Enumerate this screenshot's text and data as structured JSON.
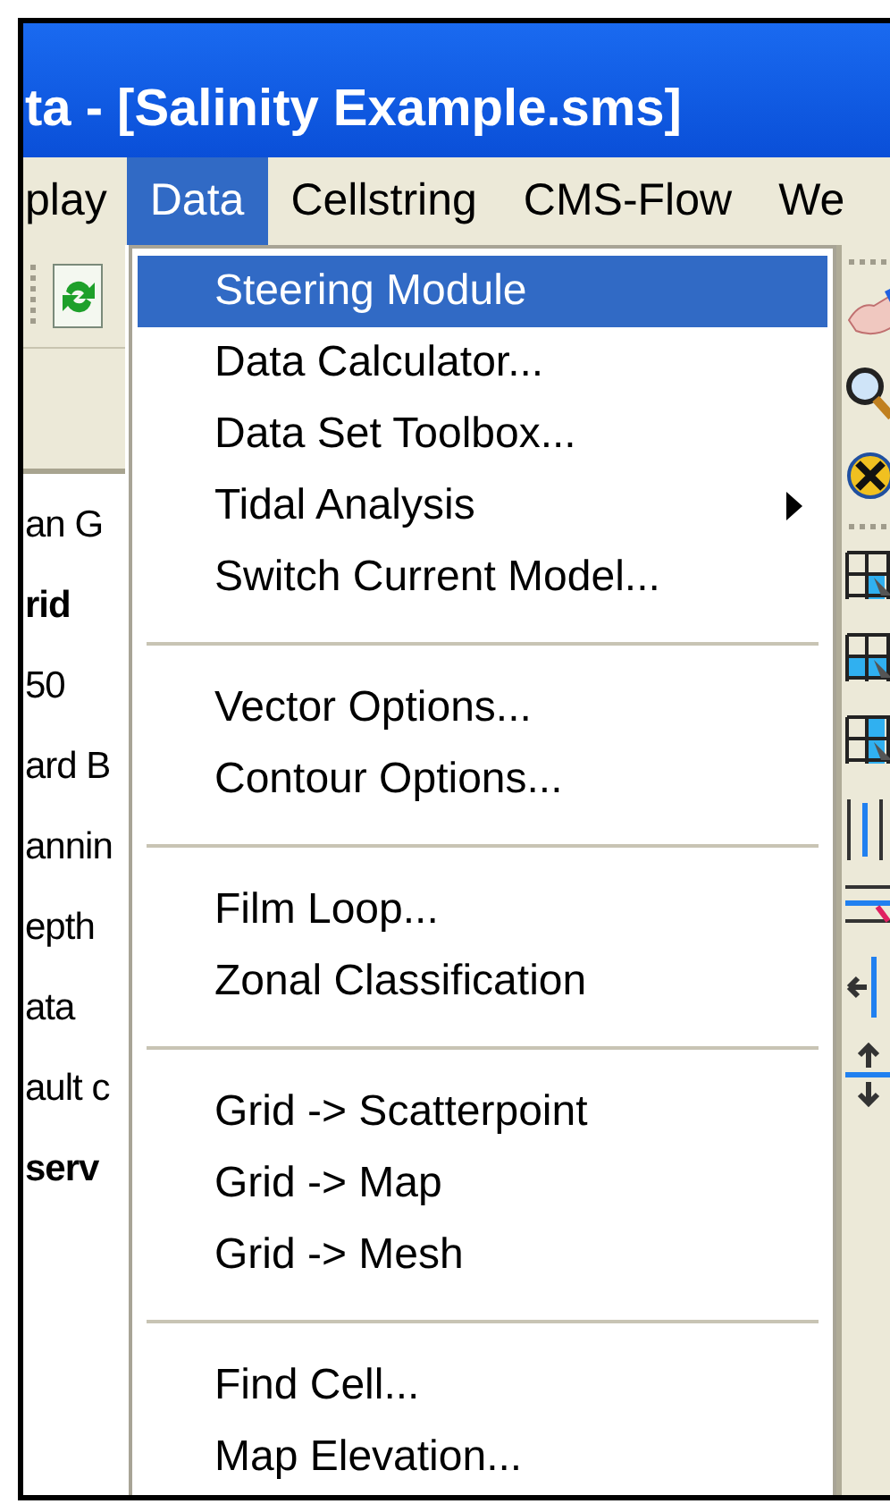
{
  "window": {
    "title": "ta - [Salinity Example.sms]"
  },
  "menu_bar": [
    {
      "label": "play",
      "selected": false
    },
    {
      "label": "Data",
      "selected": true
    },
    {
      "label": "Cellstring",
      "selected": false
    },
    {
      "label": "CMS-Flow",
      "selected": false
    },
    {
      "label": "We",
      "selected": false
    }
  ],
  "tree": {
    "items": [
      {
        "label": "an G",
        "bold": false
      },
      {
        "label": "rid",
        "bold": true
      },
      {
        "label": "50",
        "bold": false
      },
      {
        "label": "ard B",
        "bold": false
      },
      {
        "label": "annin",
        "bold": false
      },
      {
        "label": "epth",
        "bold": false
      },
      {
        "label": "ata",
        "bold": false
      },
      {
        "label": "ault c",
        "bold": false
      },
      {
        "label": "serv",
        "bold": true
      }
    ]
  },
  "data_menu": {
    "items": [
      {
        "kind": "item",
        "label": "Steering Module",
        "selected": true,
        "submenu": false
      },
      {
        "kind": "item",
        "label": "Data Calculator...",
        "selected": false,
        "submenu": false
      },
      {
        "kind": "item",
        "label": "Data Set Toolbox...",
        "selected": false,
        "submenu": false
      },
      {
        "kind": "item",
        "label": "Tidal Analysis",
        "selected": false,
        "submenu": true
      },
      {
        "kind": "item",
        "label": "Switch Current Model...",
        "selected": false,
        "submenu": false
      },
      {
        "kind": "separator"
      },
      {
        "kind": "item",
        "label": "Vector Options...",
        "selected": false,
        "submenu": false
      },
      {
        "kind": "item",
        "label": "Contour Options...",
        "selected": false,
        "submenu": false
      },
      {
        "kind": "separator"
      },
      {
        "kind": "item",
        "label": "Film Loop...",
        "selected": false,
        "submenu": false
      },
      {
        "kind": "item",
        "label": "Zonal Classification",
        "selected": false,
        "submenu": false
      },
      {
        "kind": "separator"
      },
      {
        "kind": "item",
        "label": "Grid -> Scatterpoint",
        "selected": false,
        "submenu": false
      },
      {
        "kind": "item",
        "label": "Grid -> Map",
        "selected": false,
        "submenu": false
      },
      {
        "kind": "item",
        "label": "Grid -> Mesh",
        "selected": false,
        "submenu": false
      },
      {
        "kind": "separator"
      },
      {
        "kind": "item",
        "label": "Find Cell...",
        "selected": false,
        "submenu": false
      },
      {
        "kind": "item",
        "label": "Map Elevation...",
        "selected": false,
        "submenu": false
      }
    ]
  }
}
